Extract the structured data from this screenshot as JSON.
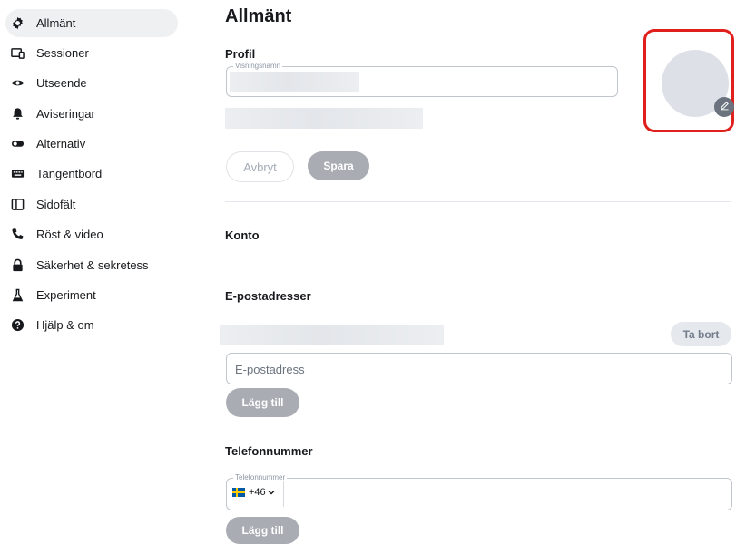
{
  "sidebar": {
    "items": [
      {
        "label": "Allmänt",
        "icon": "gear-icon",
        "active": true
      },
      {
        "label": "Sessioner",
        "icon": "devices-icon"
      },
      {
        "label": "Utseende",
        "icon": "eye-icon"
      },
      {
        "label": "Aviseringar",
        "icon": "bell-icon"
      },
      {
        "label": "Alternativ",
        "icon": "toggle-icon"
      },
      {
        "label": "Tangentbord",
        "icon": "keyboard-icon"
      },
      {
        "label": "Sidofält",
        "icon": "sidebar-icon"
      },
      {
        "label": "Röst & video",
        "icon": "phone-icon"
      },
      {
        "label": "Säkerhet & sekretess",
        "icon": "lock-icon"
      },
      {
        "label": "Experiment",
        "icon": "flask-icon"
      },
      {
        "label": "Hjälp & om",
        "icon": "help-icon"
      }
    ]
  },
  "main": {
    "title": "Allmänt",
    "profile": {
      "heading": "Profil",
      "display_name_label": "Visningsnamn",
      "cancel_label": "Avbryt",
      "save_label": "Spara"
    },
    "account": {
      "heading": "Konto"
    },
    "email": {
      "heading": "E-postadresser",
      "remove_label": "Ta bort",
      "placeholder": "E-postadress",
      "add_label": "Lägg till"
    },
    "phone": {
      "heading": "Telefonnummer",
      "field_label": "Telefonnummer",
      "country_code": "+46",
      "add_label": "Lägg till"
    }
  },
  "colors": {
    "highlight_border": "#e0201c",
    "active_nav_bg": "#eef0f2",
    "button_disabled": "#a9adb3"
  }
}
